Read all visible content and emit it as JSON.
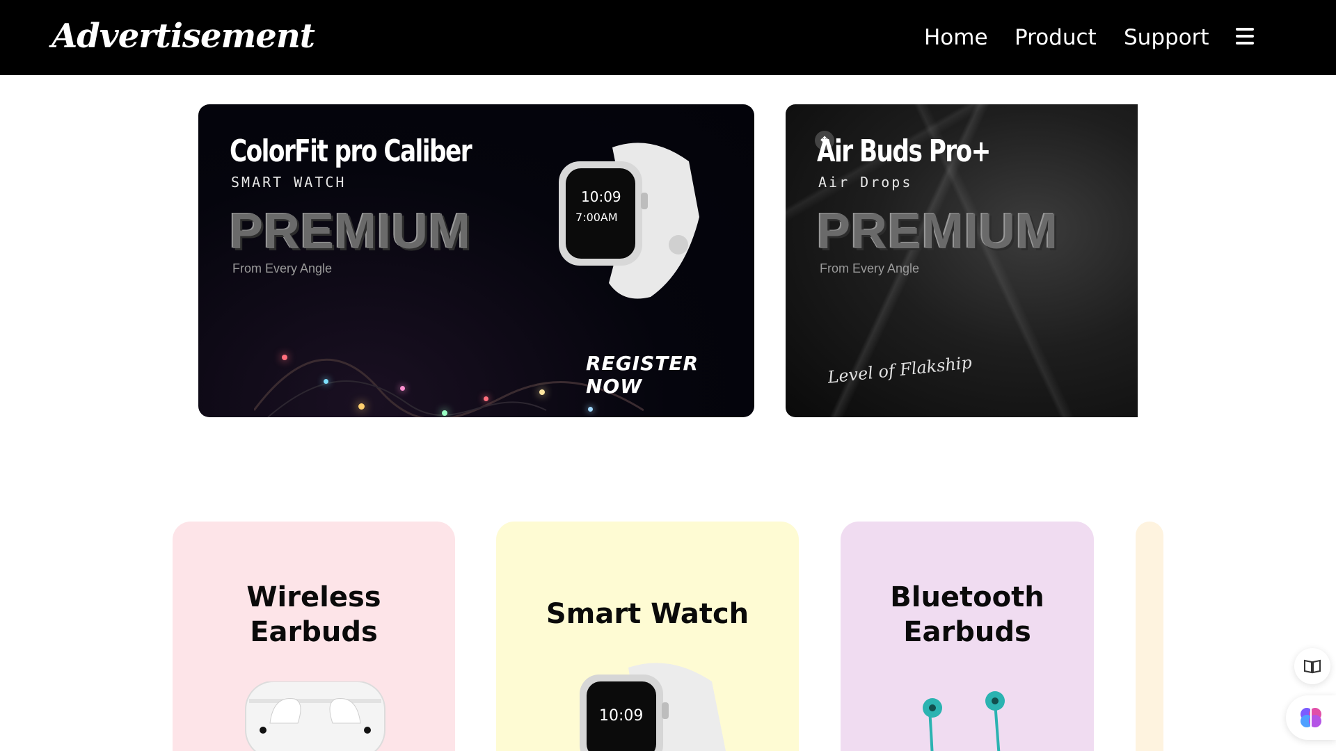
{
  "nav": {
    "logo": "Advertisement",
    "links": [
      "Home",
      "Product",
      "Support"
    ],
    "menu_icon": "hamburger-menu-icon"
  },
  "banners": [
    {
      "title": "ColorFit pro Caliber",
      "subtitle": "SMART WATCH",
      "premium": "PREMIUM",
      "tagline": "From Every Angle",
      "cta": "REGISTER NOW"
    },
    {
      "title": "Air Buds Pro+",
      "subtitle": "Air Drops",
      "premium": "PREMIUM",
      "tagline": "From Every Angle",
      "script": "Level of Flakship"
    }
  ],
  "cards": [
    {
      "title_line1": "Wireless",
      "title_line2": "Earbuds",
      "bg": "#fde4e8"
    },
    {
      "title_line1": "Smart Watch",
      "title_line2": "",
      "bg": "#fefbd3"
    },
    {
      "title_line1": "Bluetooth",
      "title_line2": "Earbuds",
      "bg": "#f0dcf1"
    },
    {
      "title_line1": "",
      "title_line2": "",
      "bg": "#fef3df"
    }
  ],
  "side_buttons": [
    "reader-mode-icon",
    "brain-assistant-icon"
  ],
  "colors": {
    "navbar": "#000000",
    "accent_teal": "#2bb3b1"
  }
}
